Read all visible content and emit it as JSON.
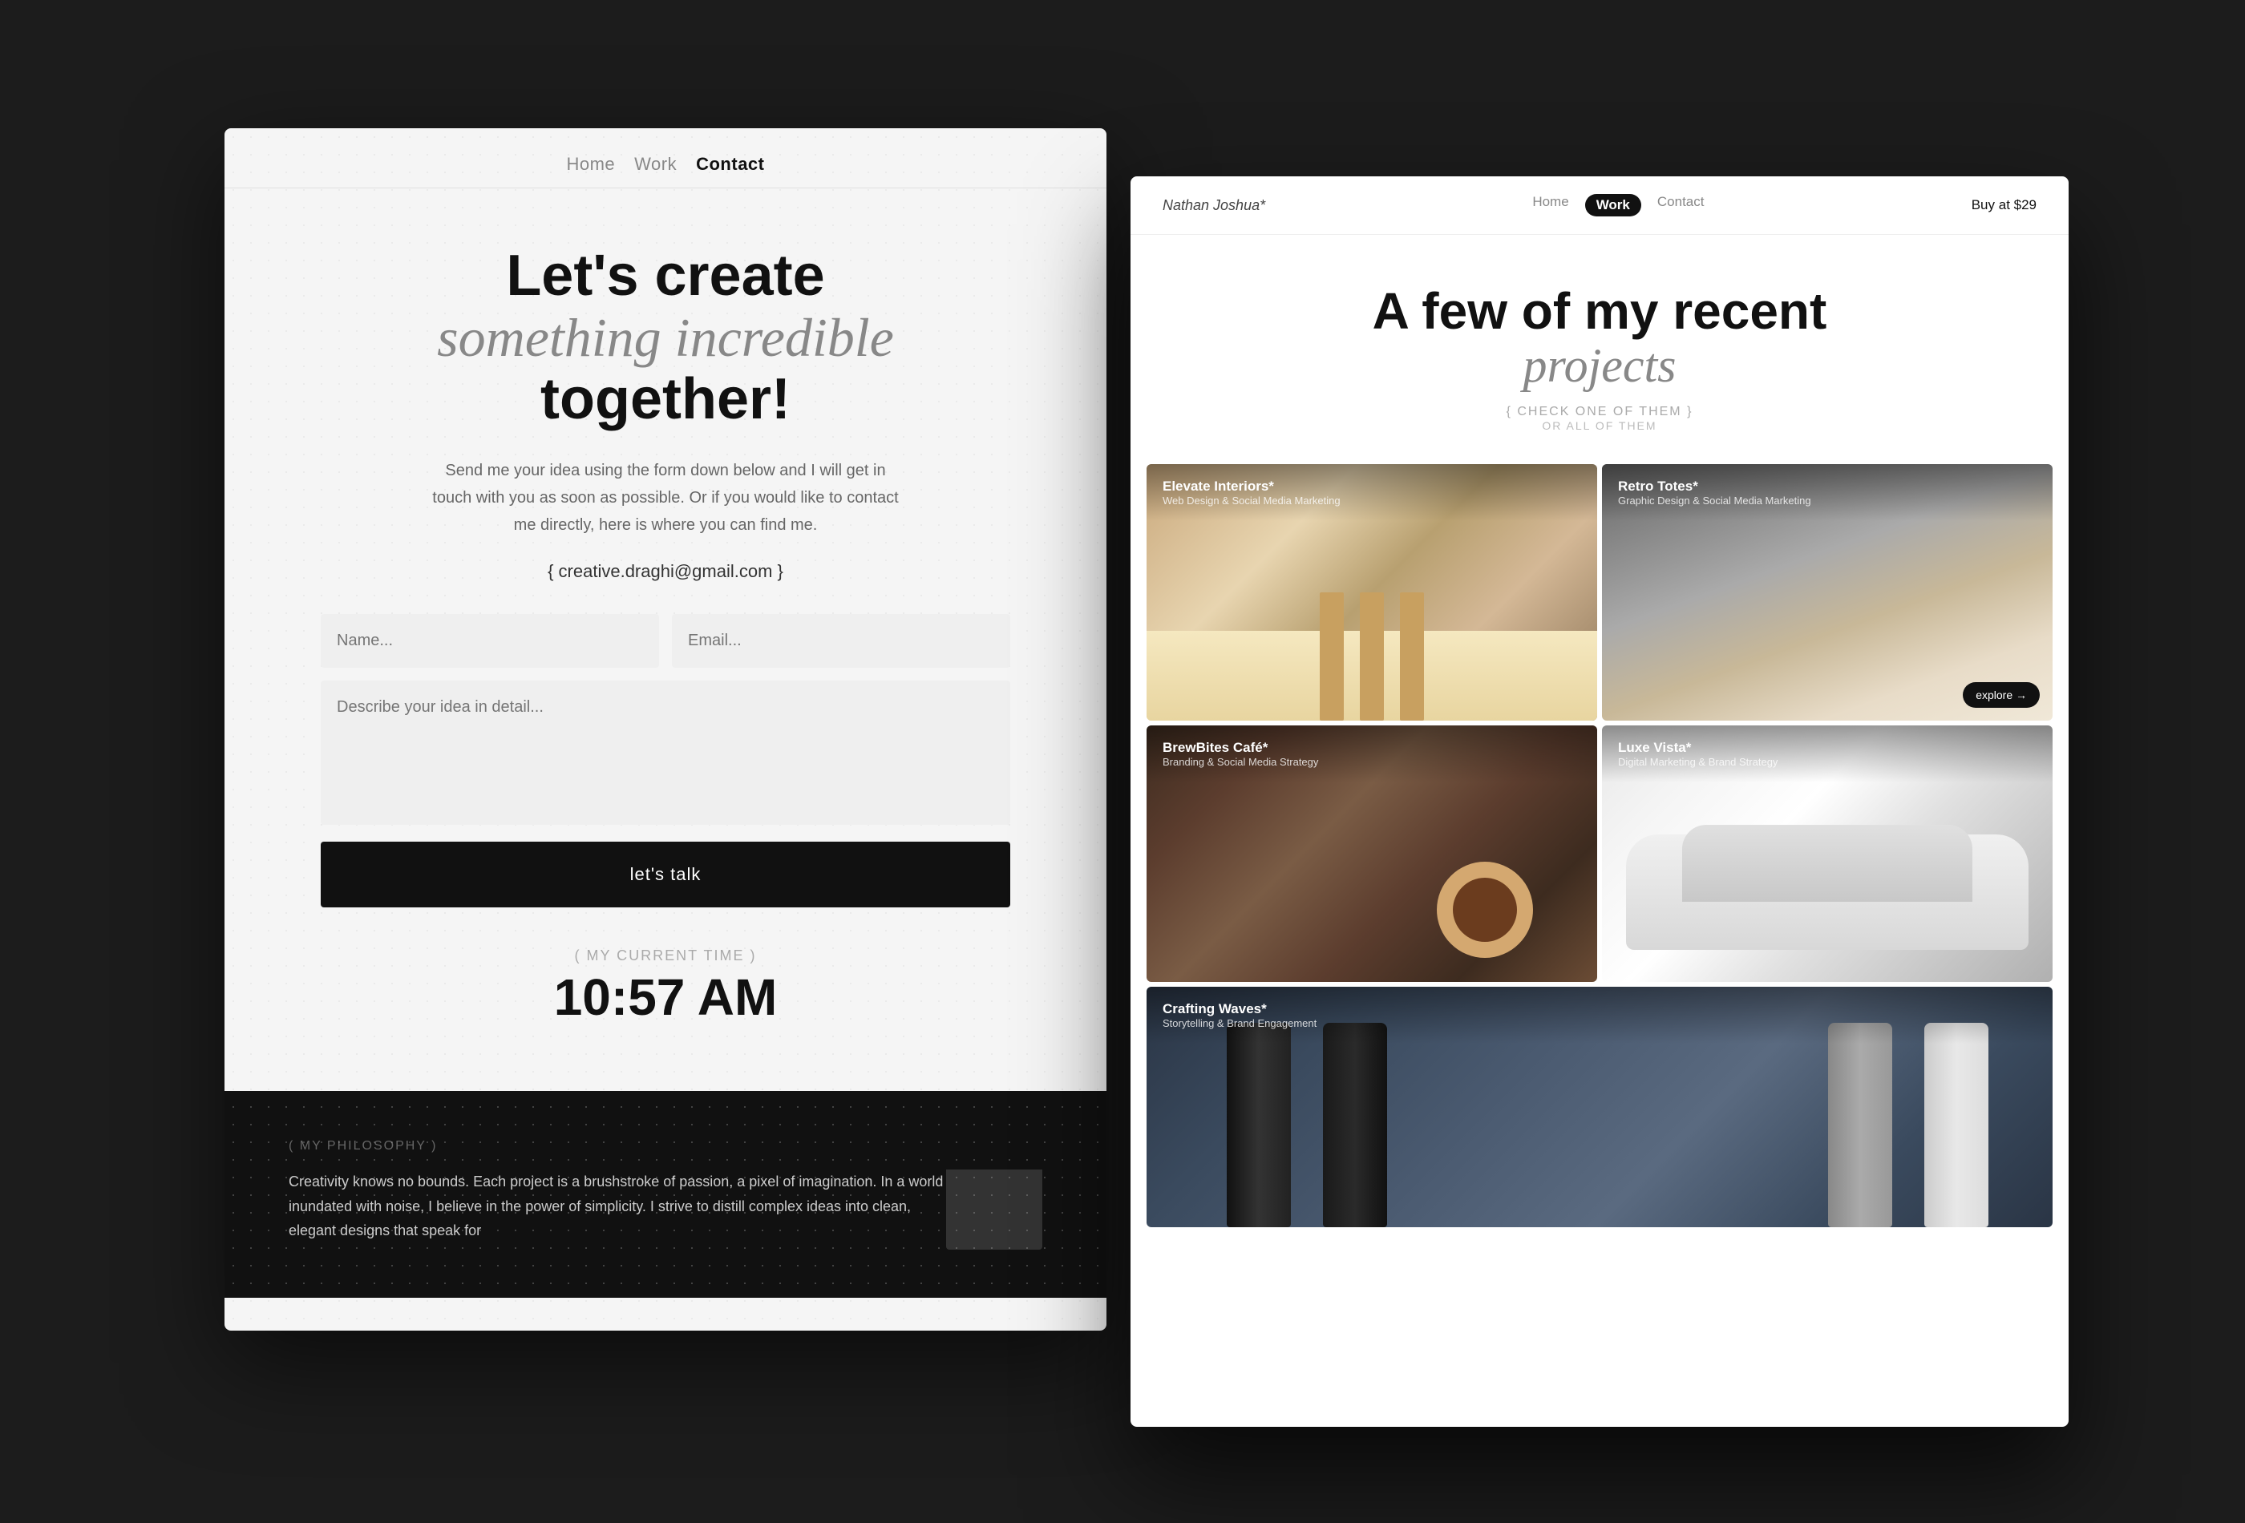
{
  "background": {
    "color": "#1c1c1c"
  },
  "contact_page": {
    "nav": {
      "items": [
        {
          "label": "Home",
          "active": false
        },
        {
          "label": "Work",
          "active": false
        },
        {
          "label": "Contact",
          "active": true
        }
      ]
    },
    "headline_line1": "Let's create",
    "headline_line2": "something incredible",
    "headline_line3": "together!",
    "subtext": "Send me your idea using the form down below and I will get in touch with you as soon as possible. Or if you would like to contact me directly, here is where you can find me.",
    "email_display": "{ creative.draghi@gmail.com }",
    "form": {
      "name_placeholder": "Name...",
      "email_placeholder": "Email...",
      "message_placeholder": "Describe your idea in detail...",
      "submit_label": "let's talk"
    },
    "time_section": {
      "label": "( MY CURRENT TIME )",
      "value": "10:57 AM"
    },
    "footer": {
      "label": "( MY PHILOSOPHY )",
      "text": "Creativity knows no bounds. Each project is a brushstroke of passion, a pixel of imagination. In a world inundated with noise, I believe in the power of simplicity. I strive to distill complex ideas into clean, elegant designs that speak for"
    }
  },
  "work_page": {
    "nav": {
      "brand": "Nathan Joshua*",
      "items": [
        {
          "label": "Home",
          "active": false
        },
        {
          "label": "Work",
          "active": true
        },
        {
          "label": "Contact",
          "active": false
        }
      ],
      "buy_label": "Buy at $29"
    },
    "hero": {
      "title_line1": "A few of my recent",
      "title_line2": "projects",
      "sub1": "{ CHECK ONE OF THEM }",
      "sub2": "OR ALL OF THEM"
    },
    "projects": [
      {
        "id": "interiors",
        "title": "Elevate Interiors*",
        "sub": "Web Design & Social Media Marketing",
        "has_explore": false,
        "wide": false
      },
      {
        "id": "retro",
        "title": "Retro Totes*",
        "sub": "Graphic Design & Social Media Marketing",
        "has_explore": true,
        "explore_label": "explore →",
        "wide": false
      },
      {
        "id": "brew",
        "title": "BrewBites Café*",
        "sub": "Branding & Social Media Strategy",
        "has_explore": false,
        "wide": false
      },
      {
        "id": "luxe",
        "title": "Luxe Vista*",
        "sub": "Digital Marketing & Brand Strategy",
        "has_explore": false,
        "wide": false
      },
      {
        "id": "crafting",
        "title": "Crafting Waves*",
        "sub": "Storytelling & Brand Engagement",
        "has_explore": false,
        "wide": true
      }
    ]
  }
}
